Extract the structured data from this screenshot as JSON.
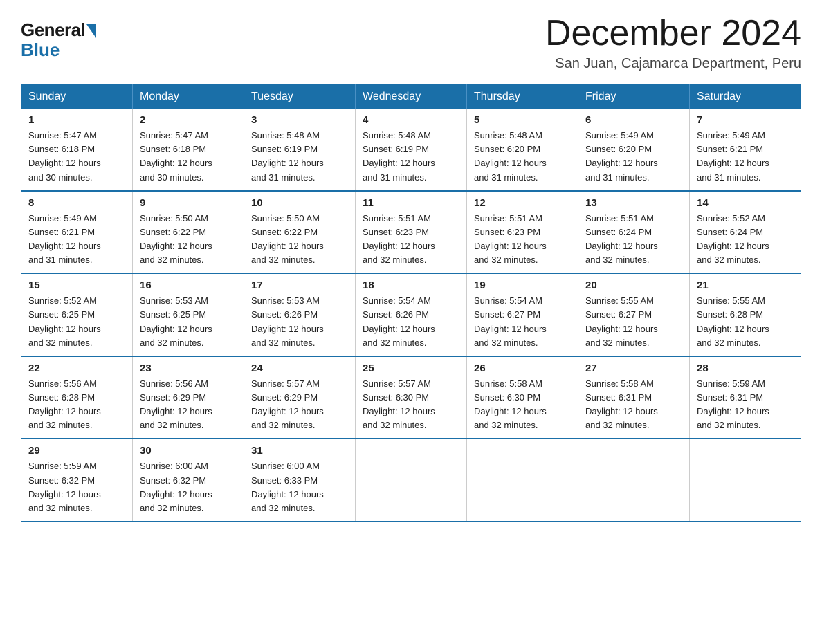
{
  "logo": {
    "general": "General",
    "blue": "Blue"
  },
  "header": {
    "title": "December 2024",
    "location": "San Juan, Cajamarca Department, Peru"
  },
  "weekdays": [
    "Sunday",
    "Monday",
    "Tuesday",
    "Wednesday",
    "Thursday",
    "Friday",
    "Saturday"
  ],
  "weeks": [
    [
      {
        "day": "1",
        "sunrise": "5:47 AM",
        "sunset": "6:18 PM",
        "daylight": "12 hours and 30 minutes."
      },
      {
        "day": "2",
        "sunrise": "5:47 AM",
        "sunset": "6:18 PM",
        "daylight": "12 hours and 30 minutes."
      },
      {
        "day": "3",
        "sunrise": "5:48 AM",
        "sunset": "6:19 PM",
        "daylight": "12 hours and 31 minutes."
      },
      {
        "day": "4",
        "sunrise": "5:48 AM",
        "sunset": "6:19 PM",
        "daylight": "12 hours and 31 minutes."
      },
      {
        "day": "5",
        "sunrise": "5:48 AM",
        "sunset": "6:20 PM",
        "daylight": "12 hours and 31 minutes."
      },
      {
        "day": "6",
        "sunrise": "5:49 AM",
        "sunset": "6:20 PM",
        "daylight": "12 hours and 31 minutes."
      },
      {
        "day": "7",
        "sunrise": "5:49 AM",
        "sunset": "6:21 PM",
        "daylight": "12 hours and 31 minutes."
      }
    ],
    [
      {
        "day": "8",
        "sunrise": "5:49 AM",
        "sunset": "6:21 PM",
        "daylight": "12 hours and 31 minutes."
      },
      {
        "day": "9",
        "sunrise": "5:50 AM",
        "sunset": "6:22 PM",
        "daylight": "12 hours and 32 minutes."
      },
      {
        "day": "10",
        "sunrise": "5:50 AM",
        "sunset": "6:22 PM",
        "daylight": "12 hours and 32 minutes."
      },
      {
        "day": "11",
        "sunrise": "5:51 AM",
        "sunset": "6:23 PM",
        "daylight": "12 hours and 32 minutes."
      },
      {
        "day": "12",
        "sunrise": "5:51 AM",
        "sunset": "6:23 PM",
        "daylight": "12 hours and 32 minutes."
      },
      {
        "day": "13",
        "sunrise": "5:51 AM",
        "sunset": "6:24 PM",
        "daylight": "12 hours and 32 minutes."
      },
      {
        "day": "14",
        "sunrise": "5:52 AM",
        "sunset": "6:24 PM",
        "daylight": "12 hours and 32 minutes."
      }
    ],
    [
      {
        "day": "15",
        "sunrise": "5:52 AM",
        "sunset": "6:25 PM",
        "daylight": "12 hours and 32 minutes."
      },
      {
        "day": "16",
        "sunrise": "5:53 AM",
        "sunset": "6:25 PM",
        "daylight": "12 hours and 32 minutes."
      },
      {
        "day": "17",
        "sunrise": "5:53 AM",
        "sunset": "6:26 PM",
        "daylight": "12 hours and 32 minutes."
      },
      {
        "day": "18",
        "sunrise": "5:54 AM",
        "sunset": "6:26 PM",
        "daylight": "12 hours and 32 minutes."
      },
      {
        "day": "19",
        "sunrise": "5:54 AM",
        "sunset": "6:27 PM",
        "daylight": "12 hours and 32 minutes."
      },
      {
        "day": "20",
        "sunrise": "5:55 AM",
        "sunset": "6:27 PM",
        "daylight": "12 hours and 32 minutes."
      },
      {
        "day": "21",
        "sunrise": "5:55 AM",
        "sunset": "6:28 PM",
        "daylight": "12 hours and 32 minutes."
      }
    ],
    [
      {
        "day": "22",
        "sunrise": "5:56 AM",
        "sunset": "6:28 PM",
        "daylight": "12 hours and 32 minutes."
      },
      {
        "day": "23",
        "sunrise": "5:56 AM",
        "sunset": "6:29 PM",
        "daylight": "12 hours and 32 minutes."
      },
      {
        "day": "24",
        "sunrise": "5:57 AM",
        "sunset": "6:29 PM",
        "daylight": "12 hours and 32 minutes."
      },
      {
        "day": "25",
        "sunrise": "5:57 AM",
        "sunset": "6:30 PM",
        "daylight": "12 hours and 32 minutes."
      },
      {
        "day": "26",
        "sunrise": "5:58 AM",
        "sunset": "6:30 PM",
        "daylight": "12 hours and 32 minutes."
      },
      {
        "day": "27",
        "sunrise": "5:58 AM",
        "sunset": "6:31 PM",
        "daylight": "12 hours and 32 minutes."
      },
      {
        "day": "28",
        "sunrise": "5:59 AM",
        "sunset": "6:31 PM",
        "daylight": "12 hours and 32 minutes."
      }
    ],
    [
      {
        "day": "29",
        "sunrise": "5:59 AM",
        "sunset": "6:32 PM",
        "daylight": "12 hours and 32 minutes."
      },
      {
        "day": "30",
        "sunrise": "6:00 AM",
        "sunset": "6:32 PM",
        "daylight": "12 hours and 32 minutes."
      },
      {
        "day": "31",
        "sunrise": "6:00 AM",
        "sunset": "6:33 PM",
        "daylight": "12 hours and 32 minutes."
      },
      null,
      null,
      null,
      null
    ]
  ],
  "labels": {
    "sunrise": "Sunrise:",
    "sunset": "Sunset:",
    "daylight": "Daylight:"
  }
}
